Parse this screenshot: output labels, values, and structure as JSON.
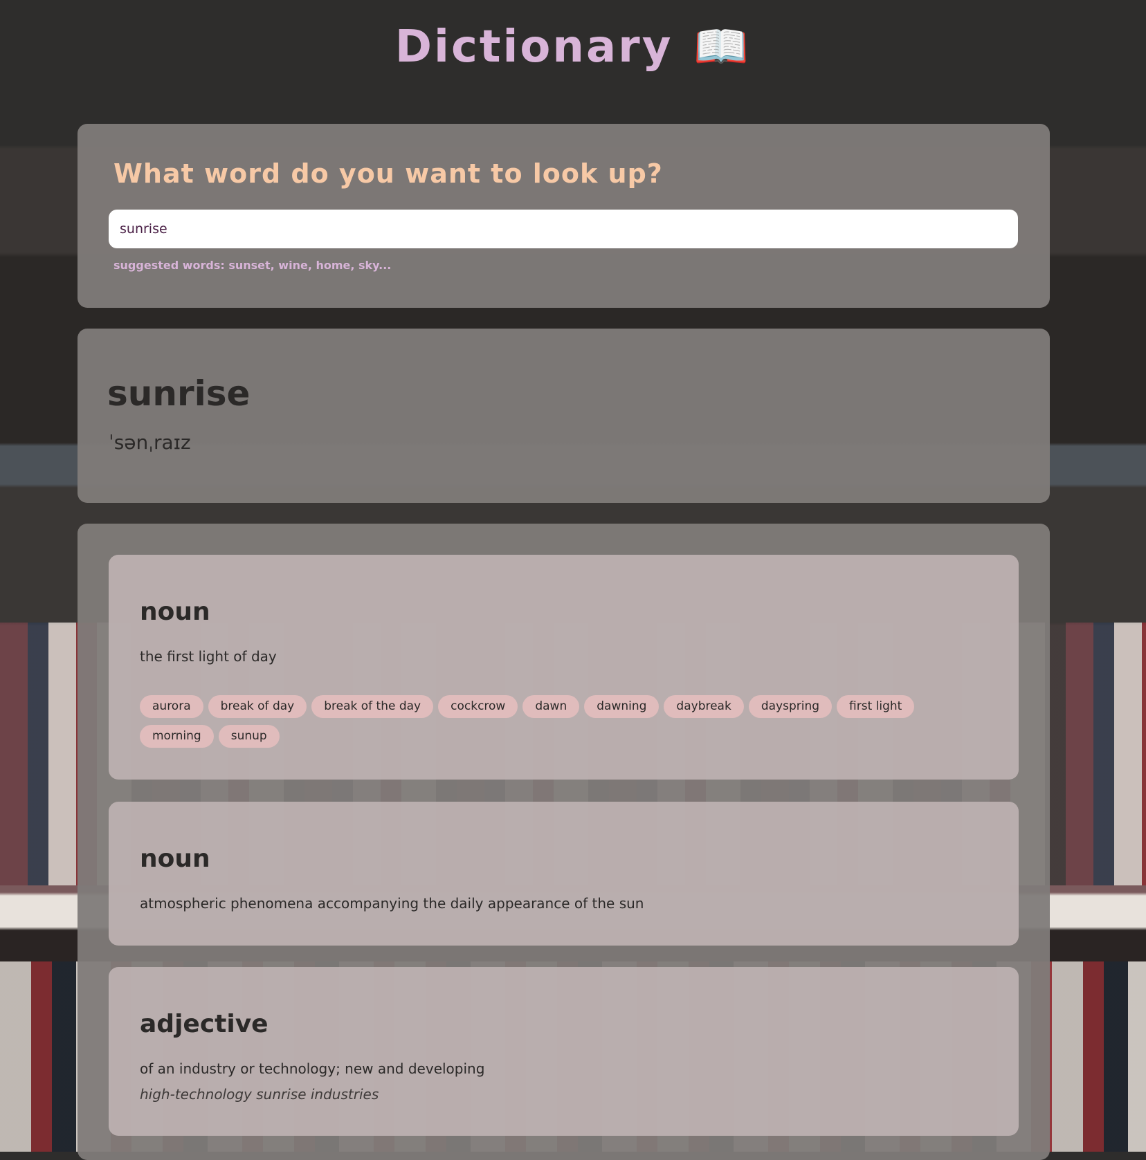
{
  "app": {
    "title": "Dictionary",
    "title_icon": "📖"
  },
  "search": {
    "question": "What word do you want to look up?",
    "value": "sunrise",
    "suggested": "suggested words: sunset, wine, home, sky..."
  },
  "result": {
    "word": "sunrise",
    "phonetic": "ˈsənˌraɪz"
  },
  "meanings": [
    {
      "part_of_speech": "noun",
      "definition": "the first light of day",
      "synonyms": [
        "aurora",
        "break of day",
        "break of the day",
        "cockcrow",
        "dawn",
        "dawning",
        "daybreak",
        "dayspring",
        "first light",
        "morning",
        "sunup"
      ]
    },
    {
      "part_of_speech": "noun",
      "definition": "atmospheric phenomena accompanying the daily appearance of the sun"
    },
    {
      "part_of_speech": "adjective",
      "definition": "of an industry or technology; new and developing",
      "example": "high-technology sunrise industries"
    }
  ],
  "colors": {
    "title": "#d8b4d8",
    "question": "#f7c9a6",
    "synonym_bg": "#e0bcbc"
  }
}
